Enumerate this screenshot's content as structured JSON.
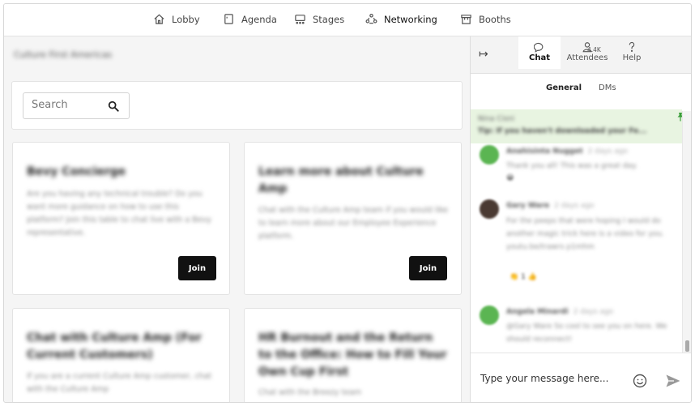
{
  "nav": {
    "items": [
      {
        "label": "Lobby",
        "icon": "home-icon"
      },
      {
        "label": "Agenda",
        "icon": "agenda-icon"
      },
      {
        "label": "Stages",
        "icon": "stages-icon"
      },
      {
        "label": "Networking",
        "icon": "networking-icon",
        "active": true
      },
      {
        "label": "Booths",
        "icon": "booths-icon"
      }
    ]
  },
  "event": {
    "title": "Culture First Americas"
  },
  "search": {
    "placeholder": "Search"
  },
  "cards": [
    {
      "title": "Bevy Concierge",
      "description": "Are you having any technical trouble? Do you want more guidance on how to use this platform? Join this table to chat live with a Bevy representative.",
      "button": "Join"
    },
    {
      "title": "Learn more about Culture Amp",
      "description": "Chat with the Culture Amp team if you would like to learn more about our Employee Experience platform.",
      "button": "Join"
    },
    {
      "title": "Chat with Culture Amp (For Current Customers)",
      "description": "If you are a current Culture Amp customer, chat with the Culture Amp"
    },
    {
      "title": "HR Burnout and the Return to the Office: How to Fill Your Own Cup First",
      "description": "Chat with the Breezy team"
    }
  ],
  "chat": {
    "tabs": [
      {
        "label": "Chat",
        "icon": "chat-bubble-icon",
        "active": true
      },
      {
        "label": "Attendees",
        "icon": "person-icon",
        "count": "4.4K"
      },
      {
        "label": "Help",
        "icon": "help-icon"
      }
    ],
    "subtabs": [
      {
        "label": "General",
        "active": true
      },
      {
        "label": "DMs"
      }
    ],
    "pinned": {
      "name": "Nina Cisni",
      "text": "Tip: If you haven't downloaded your Fe..."
    },
    "messages": [
      {
        "name": "Anahisinta Nugget",
        "time": "2 days ago",
        "text": "Thank you all! This was a great day.",
        "avatar_color": "#5bb552",
        "reaction": "😀"
      },
      {
        "name": "Gary Ware",
        "time": "2 days ago",
        "text": "For the peeps that were hoping I would do another magic trick here is a video for you. youtu.be/trawrs p1mhm",
        "avatar_color": "#4a3a33",
        "reaction": "👏 1   👍"
      },
      {
        "name": "Angela Minardi",
        "time": "2 days ago",
        "text": "@Gary Ware So cool to see you on here. We should reconnect!",
        "avatar_color": "#5bb552"
      }
    ],
    "composer": {
      "placeholder": "Type your message here..."
    }
  }
}
